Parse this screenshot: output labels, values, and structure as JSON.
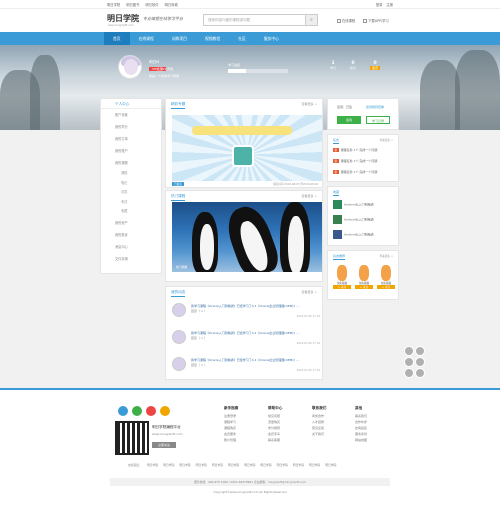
{
  "topbar": {
    "links": [
      "明日学院",
      "明日图书",
      "明日软件",
      "明日商城"
    ],
    "user": [
      "登录",
      "注册"
    ]
  },
  "header": {
    "logo": "明日学院",
    "logo_sub": "www.mingrisoft.com",
    "slogan": "专业编程在线学习平台",
    "search_placeholder": "搜索你感兴趣的课程或问题",
    "options": [
      "在线课程",
      "下载APP/学习"
    ]
  },
  "nav": {
    "items": [
      "首页",
      "在线课程",
      "训练项目",
      "视频教程",
      "社区",
      "服务中心"
    ],
    "active": 0
  },
  "profile": {
    "name": "明日M",
    "badge": "VIP会员",
    "level": "LV1  升级",
    "sign": "我是一个新的学习者哦",
    "progress_label": "学习进度",
    "progress": 0.3,
    "stats": [
      {
        "v": "1",
        "l": "学分"
      },
      {
        "v": "0",
        "l": "积分"
      },
      {
        "v": "0",
        "l": "金币"
      }
    ]
  },
  "sidebar": {
    "title": "个人中心",
    "items": [
      "账户设置",
      "我的学分",
      "我的订单",
      "我的账户",
      "我的课程"
    ],
    "subs": [
      "课程",
      "笔记",
      "问答",
      "考试",
      "收藏"
    ],
    "items2": [
      "我的资产",
      "我的投诉",
      "消息中心",
      "文件存储"
    ]
  },
  "rec": {
    "title": "精彩专题",
    "more": "查看更多 >",
    "badge": "已报名",
    "time": "报名时间 2016-08-03  至2016-08-20"
  },
  "video": {
    "title": "热门课程",
    "more": "查看更多 >",
    "caption": "热门视频"
  },
  "news": {
    "title": "我的动态",
    "more": "查看更多 >",
    "rows": [
      {
        "t": "我学习课程《Oracle入门到精通》已经学习了4.1《Oracle企业管理器(OEM)》...",
        "s": "回复（ 1 ）",
        "d": "2016-07-06 17:34"
      },
      {
        "t": "我学习课程《Oracle入门到精通》已经学习了4.1《Oracle企业管理器(OEM)》...",
        "s": "回复（ 1 ）",
        "d": "2016-07-06 17:34"
      },
      {
        "t": "我学习课程《Oracle入门到精通》已经学习了4.1《Oracle企业管理器(OEM)》...",
        "s": "回复（ 1 ）",
        "d": "2016-07-06 17:34"
      }
    ]
  },
  "signin": {
    "label": "签到：已签",
    "link": "签到规则查看",
    "btn1": "签到",
    "btn2": "学习记录"
  },
  "tasks": {
    "title": "任务",
    "more": "查看更多 >",
    "rows": [
      "课程任务 1个  完成一个问题",
      "课程任务 1个  完成一个问题",
      "课程任务 1个  完成一个问题"
    ]
  },
  "courses": {
    "title": "收藏",
    "more": "查看更多 >",
    "rows": [
      {
        "t": "Android从入门到精通",
        "s": "已收藏  2天"
      },
      {
        "t": "Android从入门到精通",
        "s": "已收藏  2天"
      },
      {
        "t": "Android从入门到精通",
        "s": "已收藏  2天"
      }
    ]
  },
  "friends": {
    "title": "好友推荐",
    "more": "查看更多 >",
    "names": [
      "兔兔猫猫",
      "兔兔猫猫",
      "兔兔猫猫"
    ],
    "btn": "+ 关注"
  },
  "footer": {
    "brand": "明日学院编程平台",
    "sub": "www.mingrisoft.com",
    "btn": "立即关注",
    "cols": [
      {
        "h": "新手指南",
        "l": [
          "注册登录",
          "课程学习",
          "课程购买",
          "会员服务",
          "账户管理"
        ]
      },
      {
        "h": "帮助中心",
        "l": [
          "常见问题",
          "流量购买",
          "学分规则",
          "会员专享",
          "联系客服"
        ]
      },
      {
        "h": "联系我们",
        "l": [
          "商务合作",
          "人才招聘",
          "意见反馈",
          "关于我们"
        ]
      },
      {
        "h": "其他",
        "l": [
          "联系我们",
          "合作伙伴",
          "友情链接",
          "服务条款",
          "网站地图"
        ]
      }
    ],
    "links": [
      "友情链接：",
      "明日学院",
      "明日学院",
      "明日学院",
      "明日学院",
      "明日学院",
      "明日学院",
      "明日学院",
      "明日学院",
      "明日学院",
      "明日学院",
      "明日学院",
      "明日学院"
    ],
    "contact": "服务热线：400-675-1066 / 0431-84978981    企业邮箱：mingrisoft@mingrisoft.com",
    "copyright": "Copyright©www.mingrisoft.com All Rights Reserved"
  }
}
